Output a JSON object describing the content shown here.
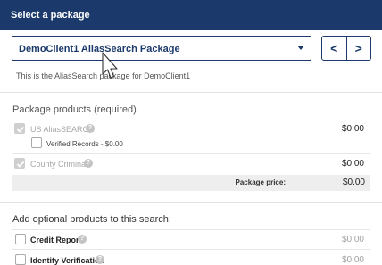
{
  "header": {
    "title": "Select a package"
  },
  "package_select": {
    "value": "DemoClient1 AliasSearch Package"
  },
  "nav": {
    "prev": "<",
    "next": ">"
  },
  "description": "This is the AliasSearch package for DemoClient1",
  "package_products": {
    "title": "Package products",
    "required": "(required)",
    "items": [
      {
        "label": "US AliasSEARCH",
        "price": "$0.00",
        "checked": true,
        "disabled": true
      },
      {
        "label": "County Criminal",
        "price": "$0.00",
        "checked": true,
        "disabled": true
      }
    ],
    "sub_option": {
      "label": "Verified Records - $0.00",
      "checked": false
    },
    "package_price_label": "Package price:",
    "package_price_value": "$0.00"
  },
  "optional_products": {
    "title": "Add optional products to this search:",
    "items": [
      {
        "label": "Credit Report",
        "price": "$0.00",
        "checked": false
      },
      {
        "label": "Identity Verification",
        "price": "$0.00",
        "checked": false
      }
    ]
  },
  "icons": {
    "dropdown": "chevron-down-icon",
    "help": "help-circle-icon",
    "check": "checkmark-icon",
    "cursor": "mouse-pointer-icon"
  },
  "colors": {
    "brand": "#1b3a6b",
    "disabled_text": "#a8a8a8",
    "help_icon": "#c4c4c4"
  }
}
